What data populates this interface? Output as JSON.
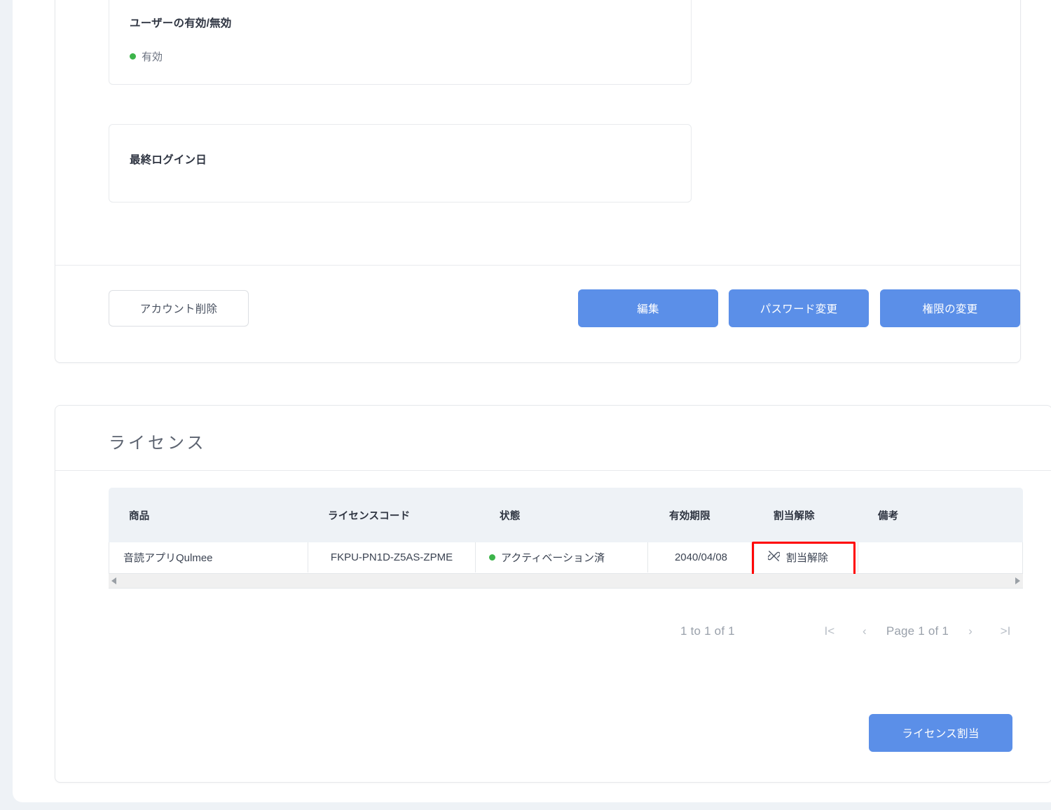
{
  "theme": {
    "page_background": "#eef2f6",
    "card_background": "#ffffff",
    "primary": "#5b8fe8",
    "status_green": "#3cb44a",
    "highlight_red": "#ff0000",
    "header_row_background": "#eef2f6"
  },
  "detail_card": {
    "status_box": {
      "label": "ユーザーの有効/無効",
      "value": "有効",
      "indicator": "green-dot"
    },
    "last_login_box": {
      "label": "最終ログイン日",
      "value": ""
    },
    "actions": {
      "delete_account": "アカウント削除",
      "edit": "編集",
      "change_password": "パスワード変更",
      "change_role": "権限の変更"
    }
  },
  "license_card": {
    "title": "ライセンス",
    "table": {
      "columns": [
        {
          "key": "product",
          "label": "商品"
        },
        {
          "key": "code",
          "label": "ライセンスコード"
        },
        {
          "key": "status",
          "label": "状態"
        },
        {
          "key": "expires",
          "label": "有効期限"
        },
        {
          "key": "unassign",
          "label": "割当解除"
        },
        {
          "key": "note",
          "label": "備考"
        }
      ],
      "rows": [
        {
          "product": "音読アプリQulmee",
          "code": "FKPU-PN1D-Z5AS-ZPME",
          "status": "アクティベーション済",
          "status_indicator": "green-dot",
          "expires": "2040/04/08",
          "unassign": "割当解除",
          "unassign_icon": "unlink-icon",
          "unassign_highlighted": true,
          "note": ""
        }
      ],
      "horizontal_scrollbar": {
        "left_arrow": "scroll-left-arrow",
        "right_arrow": "scroll-right-arrow"
      }
    },
    "pagination": {
      "summary": "1 to 1 of 1",
      "first_label": "I<",
      "previous_label": "‹",
      "page_label": "Page 1 of 1",
      "next_label": "›",
      "last_label": ">I"
    },
    "assign_button": "ライセンス割当"
  }
}
